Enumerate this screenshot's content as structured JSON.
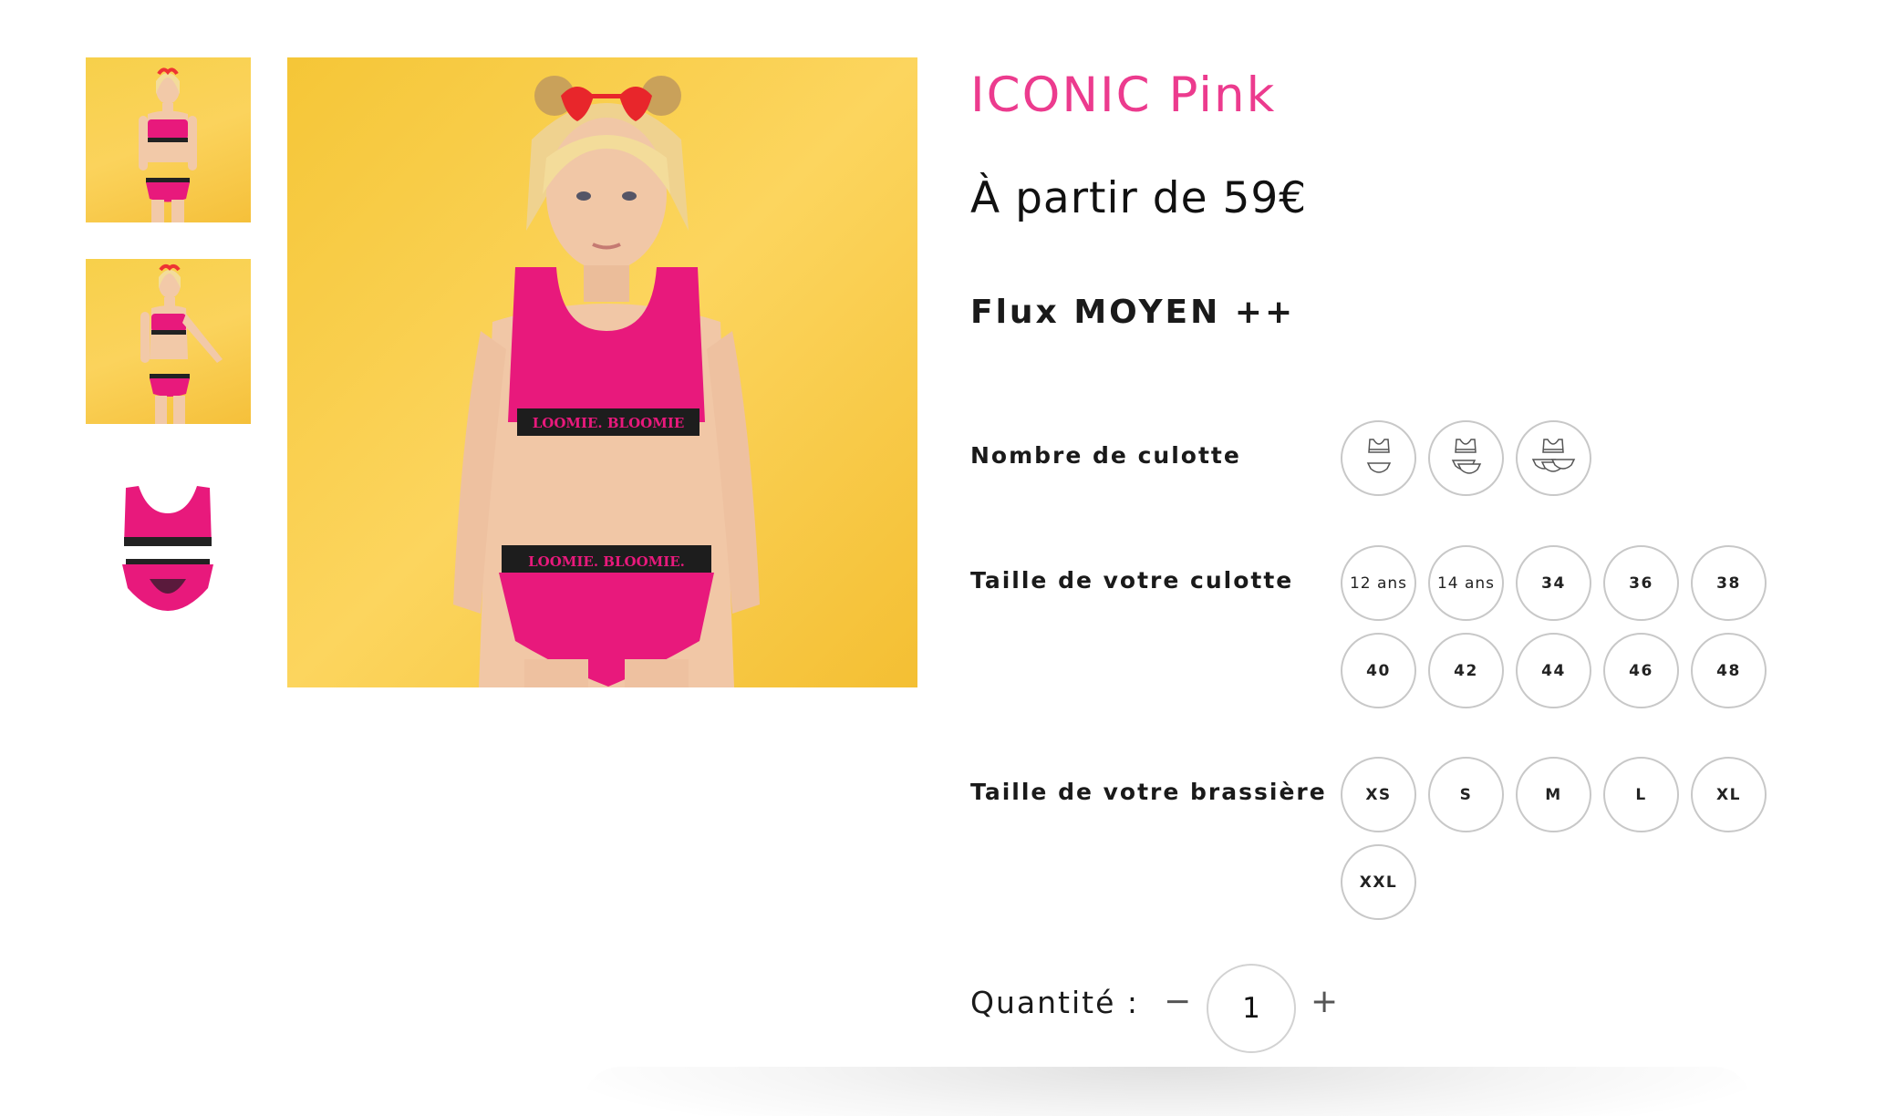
{
  "product": {
    "title": "ICONIC Pink",
    "price": "À partir de 59€",
    "flux": "Flux MOYEN ++"
  },
  "gallery": {
    "thumbnails": [
      {
        "kind": "photo-front"
      },
      {
        "kind": "photo-side"
      },
      {
        "kind": "product-flat"
      }
    ]
  },
  "options": {
    "count": {
      "label": "Nombre de culotte",
      "icons": [
        "bra-and-1-brief-icon",
        "bra-and-2-briefs-icon",
        "bra-and-3-briefs-icon"
      ]
    },
    "brief_size": {
      "label": "Taille de votre culotte",
      "values": [
        "12 ans",
        "14 ans",
        "34",
        "36",
        "38",
        "40",
        "42",
        "44",
        "46",
        "48"
      ]
    },
    "bra_size": {
      "label": "Taille de votre brassière",
      "values": [
        "XS",
        "S",
        "M",
        "L",
        "XL",
        "XXL"
      ]
    }
  },
  "quantity": {
    "label": "Quantité :",
    "minus": "−",
    "value": "1",
    "plus": "+"
  },
  "colors": {
    "accent": "#ec3b8e",
    "background_yellow": "#f7d04a",
    "garment_pink": "#e8197c"
  }
}
